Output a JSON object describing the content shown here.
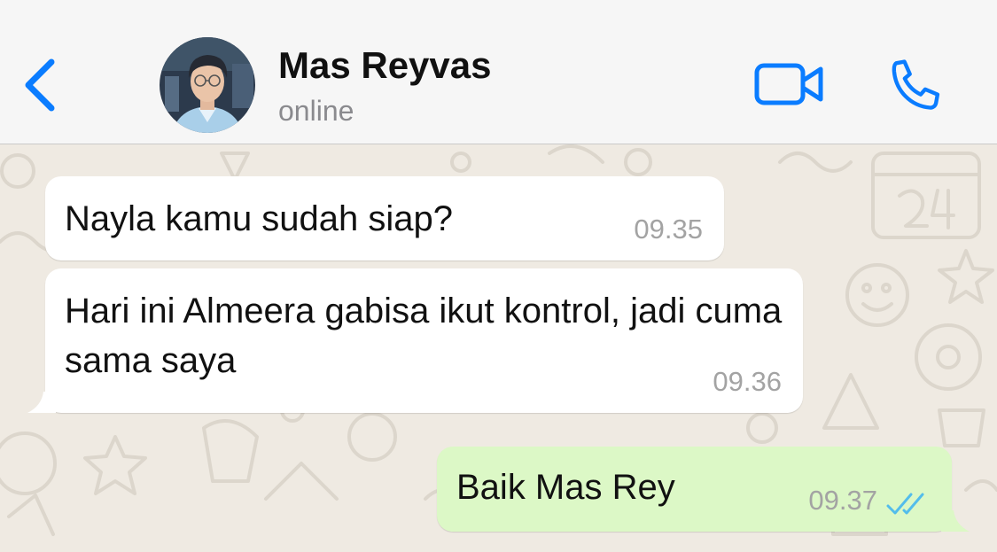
{
  "header": {
    "contact_name": "Mas Reyvas",
    "contact_status": "online",
    "icons": {
      "back": "chevron-left-icon",
      "video": "video-camera-icon",
      "call": "phone-icon"
    }
  },
  "messages": [
    {
      "direction": "incoming",
      "text": "Nayla kamu sudah siap?",
      "time": "09.35"
    },
    {
      "direction": "incoming",
      "text": "Hari ini Almeera gabisa ikut kontrol, jadi cuma sama saya",
      "time": "09.36"
    },
    {
      "direction": "outgoing",
      "text": "Baik Mas Rey",
      "time": "09.37",
      "read_status": "read"
    }
  ],
  "colors": {
    "accent": "#0a7cff",
    "incoming_bubble": "#ffffff",
    "outgoing_bubble": "#dcf8c6",
    "chat_background": "#efeae2",
    "read_ticks": "#53bdeb"
  }
}
